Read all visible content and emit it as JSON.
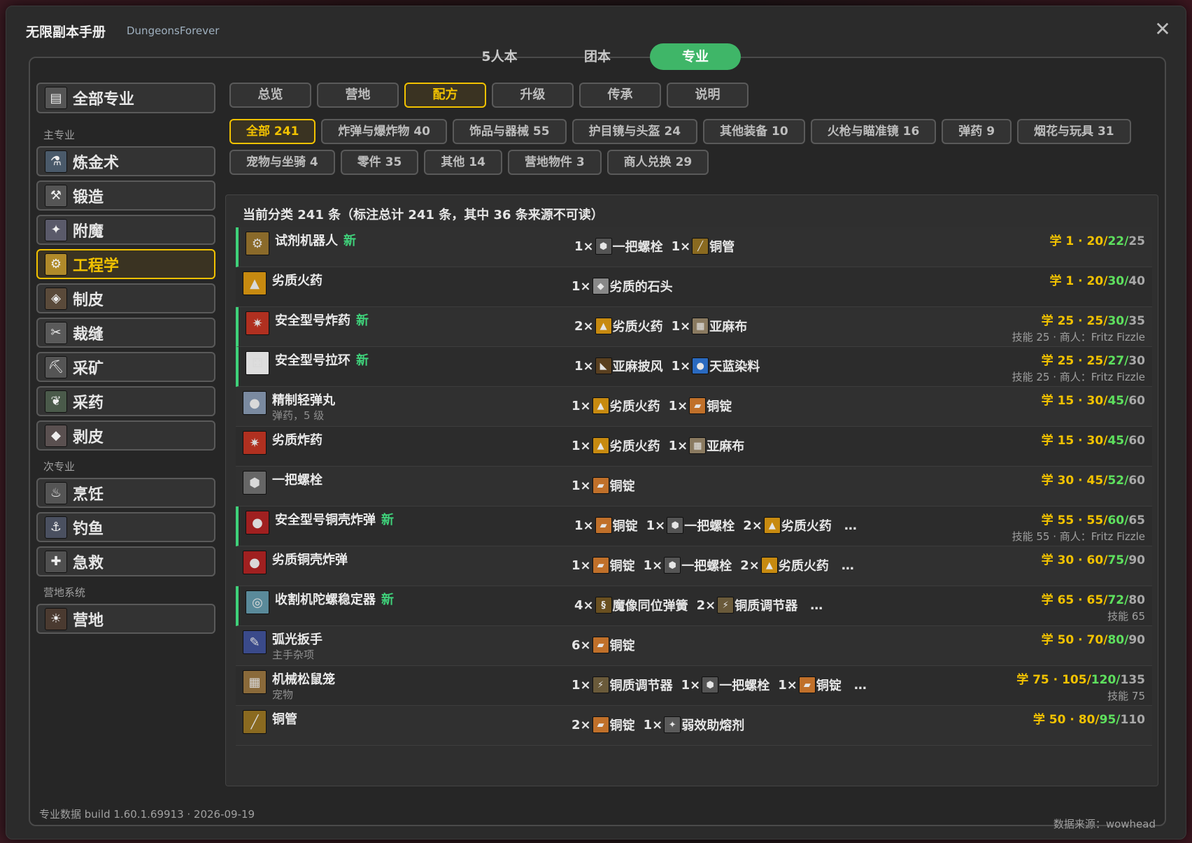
{
  "window": {
    "title": "无限副本手册",
    "subtitle": "DungeonsForever",
    "close_label": "✕"
  },
  "top_tabs": [
    {
      "label": "5人本"
    },
    {
      "label": "团本"
    },
    {
      "label": "专业",
      "active": true
    }
  ],
  "sidebar": {
    "all_label": "全部专业",
    "primary_header": "主专业",
    "primary": [
      {
        "label": "炼金术",
        "icon": "potion-icon"
      },
      {
        "label": "锻造",
        "icon": "anvil-icon"
      },
      {
        "label": "附魔",
        "icon": "enchant-icon"
      },
      {
        "label": "工程学",
        "icon": "gear-icon",
        "active": true
      },
      {
        "label": "制皮",
        "icon": "leather-icon"
      },
      {
        "label": "裁缝",
        "icon": "thread-icon"
      },
      {
        "label": "采矿",
        "icon": "pickaxe-icon"
      },
      {
        "label": "采药",
        "icon": "herb-icon"
      },
      {
        "label": "剥皮",
        "icon": "skinning-icon"
      }
    ],
    "secondary_header": "次专业",
    "secondary": [
      {
        "label": "烹饪",
        "icon": "cooking-icon"
      },
      {
        "label": "钓鱼",
        "icon": "fishing-icon"
      },
      {
        "label": "急救",
        "icon": "first-aid-icon"
      }
    ],
    "camp_header": "营地系统",
    "camp": [
      {
        "label": "营地",
        "icon": "campfire-icon"
      }
    ]
  },
  "subtabs": [
    {
      "label": "总览"
    },
    {
      "label": "营地"
    },
    {
      "label": "配方",
      "active": true
    },
    {
      "label": "升级"
    },
    {
      "label": "传承"
    },
    {
      "label": "说明"
    }
  ],
  "filters": [
    {
      "label": "全部 241",
      "active": true
    },
    {
      "label": "炸弹与爆炸物 40"
    },
    {
      "label": "饰品与器械 55"
    },
    {
      "label": "护目镜与头盔 24"
    },
    {
      "label": "其他装备 10"
    },
    {
      "label": "火枪与瞄准镜 16"
    },
    {
      "label": "弹药 9"
    },
    {
      "label": "烟花与玩具 31"
    },
    {
      "label": "宠物与坐骑 4"
    },
    {
      "label": "零件 35"
    },
    {
      "label": "其他 14"
    },
    {
      "label": "营地物件 3"
    },
    {
      "label": "商人兑换 29"
    }
  ],
  "summary": "当前分类 241 条（标注总计 241 条，其中 36 条来源不可读）",
  "new_tag": "新",
  "recipes": [
    {
      "name": "试剂机器人",
      "new": true,
      "icon": "robot-icon",
      "reagents": [
        {
          "qty": "1×",
          "name": "一把螺栓"
        },
        {
          "qty": "1×",
          "name": "铜管"
        }
      ],
      "more": "",
      "learn": "学 1",
      "s1": "20",
      "s2": "22",
      "s3": "25",
      "note": ""
    },
    {
      "name": "劣质火药",
      "new": false,
      "icon": "powder-icon",
      "reagents": [
        {
          "qty": "1×",
          "name": "劣质的石头"
        }
      ],
      "more": "",
      "learn": "学 1",
      "s1": "20",
      "s2": "30",
      "s3": "40",
      "note": ""
    },
    {
      "name": "安全型号炸药",
      "new": true,
      "icon": "dynamite-icon",
      "reagents": [
        {
          "qty": "2×",
          "name": "劣质火药"
        },
        {
          "qty": "1×",
          "name": "亚麻布"
        }
      ],
      "more": "",
      "learn": "学 25",
      "s1": "25",
      "s2": "30",
      "s3": "35",
      "note": "技能 25 · 商人：Fritz Fizzle"
    },
    {
      "name": "安全型号拉环",
      "new": true,
      "icon": "dice-icon",
      "reagents": [
        {
          "qty": "1×",
          "name": "亚麻披风"
        },
        {
          "qty": "1×",
          "name": "天蓝染料"
        }
      ],
      "more": "",
      "learn": "学 25",
      "s1": "25",
      "s2": "27",
      "s3": "30",
      "note": "技能 25 · 商人：Fritz Fizzle"
    },
    {
      "name": "精制轻弹丸",
      "new": false,
      "icon": "shot-icon",
      "sub": "弹药，5 级",
      "reagents": [
        {
          "qty": "1×",
          "name": "劣质火药"
        },
        {
          "qty": "1×",
          "name": "铜锭"
        }
      ],
      "more": "",
      "learn": "学 15",
      "s1": "30",
      "s2": "45",
      "s3": "60",
      "note": ""
    },
    {
      "name": "劣质炸药",
      "new": false,
      "icon": "dynamite-icon",
      "reagents": [
        {
          "qty": "1×",
          "name": "劣质火药"
        },
        {
          "qty": "1×",
          "name": "亚麻布"
        }
      ],
      "more": "",
      "learn": "学 15",
      "s1": "30",
      "s2": "45",
      "s3": "60",
      "note": ""
    },
    {
      "name": "一把螺栓",
      "new": false,
      "icon": "bolt-icon",
      "reagents": [
        {
          "qty": "1×",
          "name": "铜锭"
        }
      ],
      "more": "",
      "learn": "学 30",
      "s1": "45",
      "s2": "52",
      "s3": "60",
      "note": ""
    },
    {
      "name": "安全型号铜壳炸弹",
      "new": true,
      "icon": "bomb-icon",
      "reagents": [
        {
          "qty": "1×",
          "name": "铜锭"
        },
        {
          "qty": "1×",
          "name": "一把螺栓"
        },
        {
          "qty": "2×",
          "name": "劣质火药"
        }
      ],
      "more": "…",
      "learn": "学 55",
      "s1": "55",
      "s2": "60",
      "s3": "65",
      "note": "技能 55 · 商人：Fritz Fizzle"
    },
    {
      "name": "劣质铜壳炸弹",
      "new": false,
      "icon": "bomb-icon",
      "reagents": [
        {
          "qty": "1×",
          "name": "铜锭"
        },
        {
          "qty": "1×",
          "name": "一把螺栓"
        },
        {
          "qty": "2×",
          "name": "劣质火药"
        }
      ],
      "more": "…",
      "learn": "学 30",
      "s1": "60",
      "s2": "75",
      "s3": "90",
      "note": ""
    },
    {
      "name": "收割机陀螺稳定器",
      "new": true,
      "icon": "gyro-icon",
      "reagents": [
        {
          "qty": "4×",
          "name": "魔像同位弹簧"
        },
        {
          "qty": "2×",
          "name": "铜质调节器"
        }
      ],
      "more": "…",
      "learn": "学 65",
      "s1": "65",
      "s2": "72",
      "s3": "80",
      "note": "技能 65"
    },
    {
      "name": "弧光扳手",
      "new": false,
      "icon": "wrench-icon",
      "sub": "主手杂项",
      "reagents": [
        {
          "qty": "6×",
          "name": "铜锭"
        }
      ],
      "more": "",
      "learn": "学 50",
      "s1": "70",
      "s2": "80",
      "s3": "90",
      "note": ""
    },
    {
      "name": "机械松鼠笼",
      "new": false,
      "icon": "crate-icon",
      "sub": "宠物",
      "reagents": [
        {
          "qty": "1×",
          "name": "铜质调节器"
        },
        {
          "qty": "1×",
          "name": "一把螺栓"
        },
        {
          "qty": "1×",
          "name": "铜锭"
        }
      ],
      "more": "…",
      "learn": "学 75",
      "s1": "105",
      "s2": "120",
      "s3": "135",
      "note": "技能 75"
    },
    {
      "name": "铜管",
      "new": false,
      "icon": "tube-icon",
      "reagents": [
        {
          "qty": "2×",
          "name": "铜锭"
        },
        {
          "qty": "1×",
          "name": "弱效助熔剂"
        }
      ],
      "more": "",
      "learn": "学 50",
      "s1": "80",
      "s2": "95",
      "s3": "110",
      "note": ""
    }
  ],
  "footer": {
    "build": "专业数据 build 1.60.1.69913 · 2026-09-19",
    "source": "数据来源：wowhead"
  },
  "colors": {
    "accent_green": "#3fb668",
    "active_gold": "#f2c200",
    "new_green": "#3fd17a",
    "skill_green": "#5ee05e"
  }
}
